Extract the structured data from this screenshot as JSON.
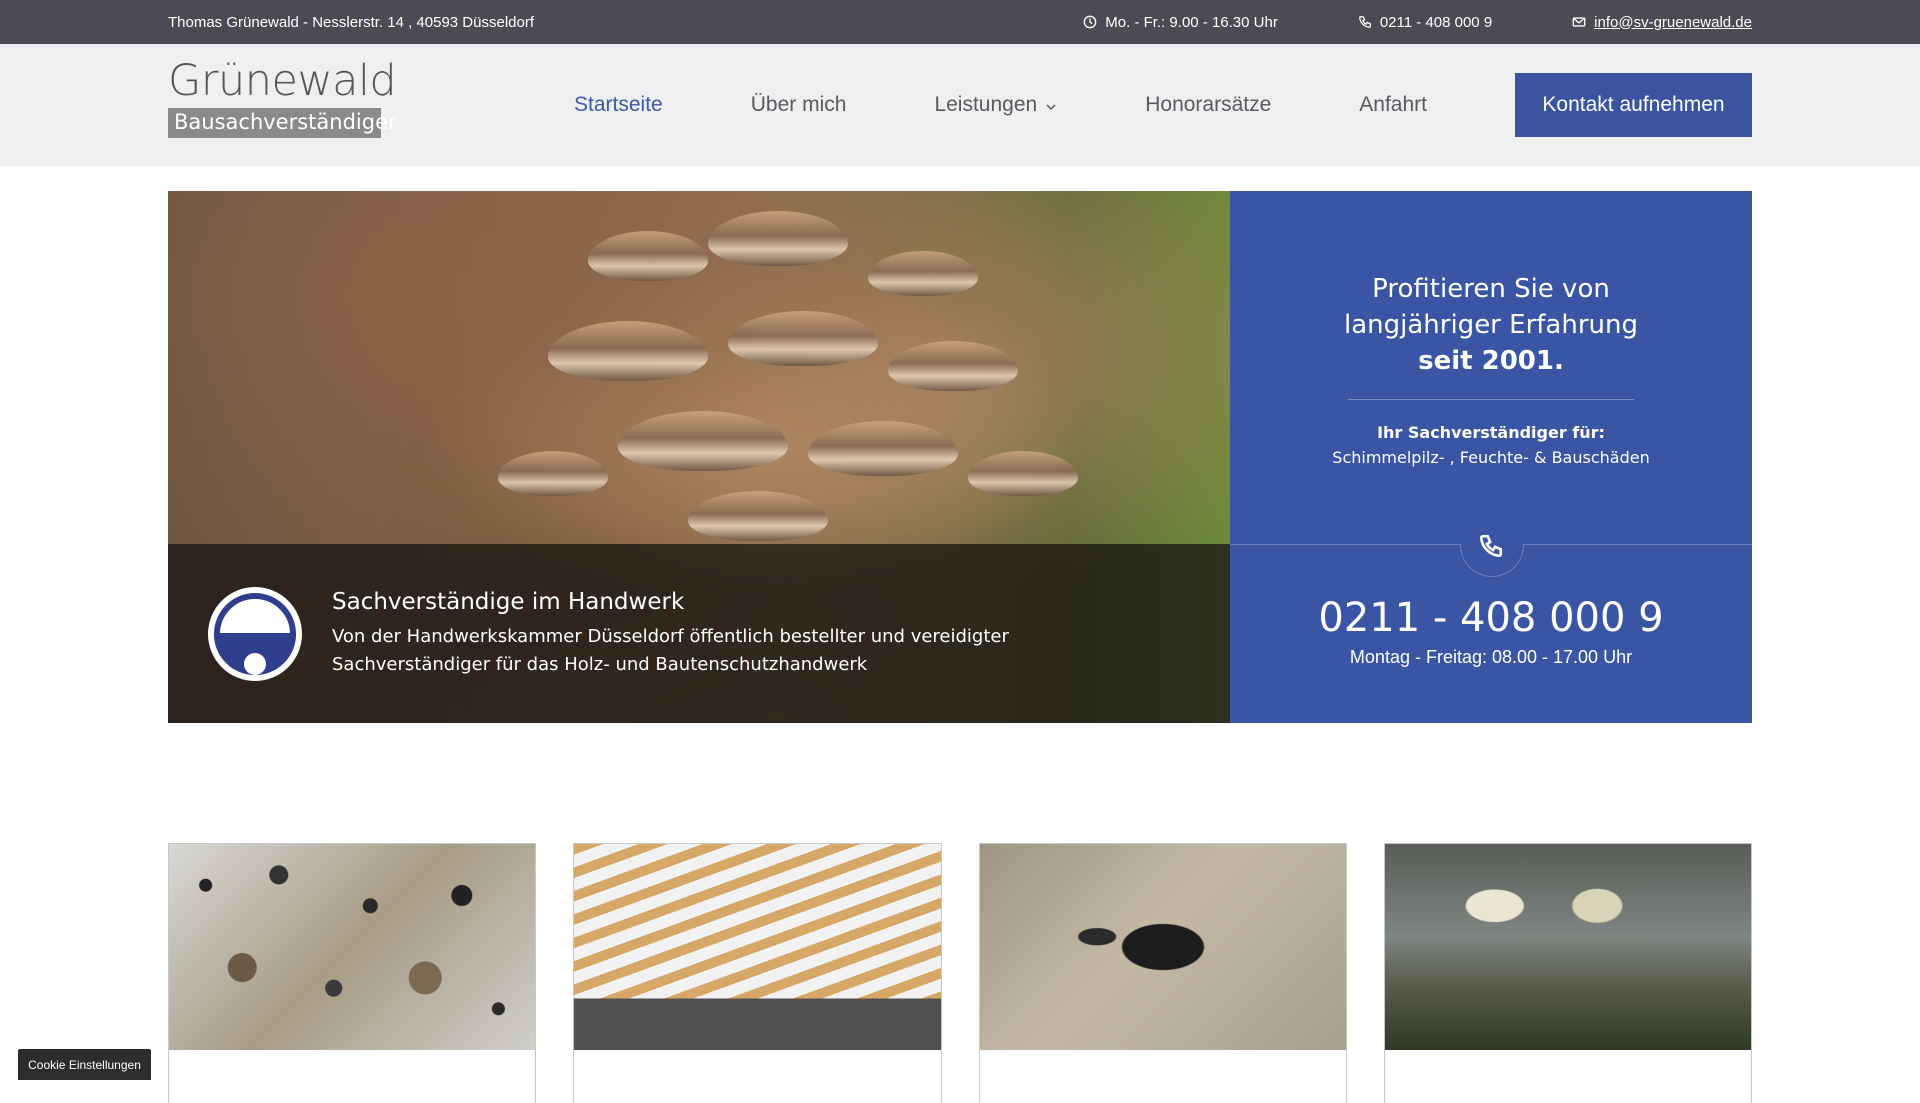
{
  "topbar": {
    "address": "Thomas Grünewald - Nesslerstr. 14 , 40593 Düsseldorf",
    "hours": "Mo. - Fr.: 9.00 - 16.30 Uhr",
    "phone": "0211 - 408 000 9",
    "email": "info@sv-gruenewald.de",
    "icons": {
      "hours": "clock-icon",
      "phone": "phone-icon",
      "email": "mail-icon"
    }
  },
  "logo": {
    "name": "Grünewald",
    "subtitle": "Bausachverständiger"
  },
  "nav": {
    "items": [
      {
        "label": "Startseite",
        "active": true
      },
      {
        "label": "Über mich"
      },
      {
        "label": "Leistungen",
        "has_dropdown": true
      },
      {
        "label": "Honorarsätze"
      },
      {
        "label": "Anfahrt"
      }
    ],
    "cta": "Kontakt aufnehmen"
  },
  "hero": {
    "caption_title": "Sachverständige im Handwerk",
    "caption_line1": "Von der Handwerkskammer Düsseldorf öffentlich bestellter und vereidigter",
    "caption_line2": "Sachverständiger für das Holz- und Bautenschutzhandwerk",
    "claim_line1": "Profitieren Sie von",
    "claim_line2": "langjähriger Erfahrung",
    "claim_bold": "seit 2001.",
    "for_label": "Ihr Sachverständiger für:",
    "for_text": "Schimmelpilz- , Feuchte- & Bauschäden",
    "phone_number": "0211 - 408 000 9",
    "phone_hours": "Montag - Freitag: 08.00 - 17.00 Uhr"
  },
  "cookie_button": "Cookie Einstellungen",
  "colors": {
    "primary": "#3a55a3",
    "topbar": "#4b4c51",
    "header_bg": "#eeeff1",
    "nav_active": "#3b5aa5"
  }
}
